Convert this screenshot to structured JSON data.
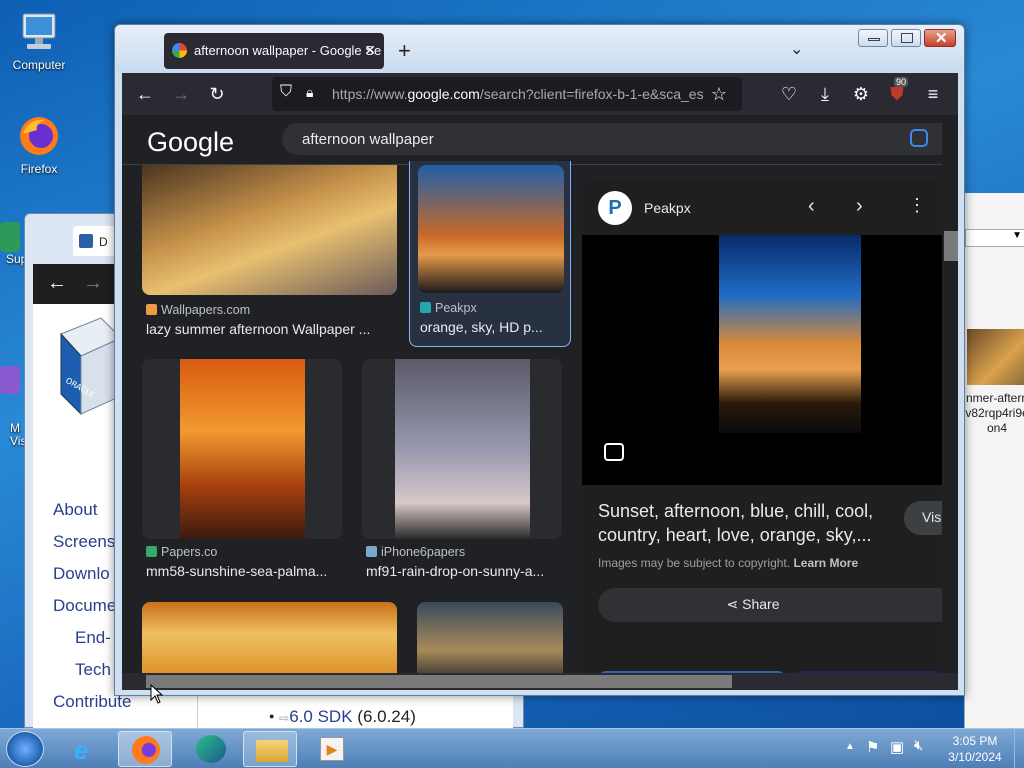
{
  "desktop": {
    "icons": [
      {
        "label": "Computer"
      },
      {
        "label": "Firefox"
      },
      {
        "label": "Sup"
      },
      {
        "label": "M\nVisu"
      }
    ]
  },
  "bg_window": {
    "tab_label": "D",
    "sidebar_links": [
      "About",
      "Screens",
      "Downlo",
      "Docume",
      "End-",
      "Tech",
      "Contribute"
    ],
    "list_item": {
      "link": "6.0 SDK",
      "version": "(6.0.24)"
    }
  },
  "right_window": {
    "caption_lines": [
      "nmer-aftern",
      "v82rqp4ri9e",
      "on4"
    ]
  },
  "firefox": {
    "tab_title": "afternoon wallpaper - Google Se",
    "url_prefix": "https://www.",
    "url_domain": "google.com",
    "url_rest": "/search?client=firefox-b-1-e&sca_es",
    "notification_badge": "90",
    "google": {
      "logo": "Google",
      "query": "afternoon wallpaper",
      "results": [
        {
          "source": "Wallpapers.com",
          "title": "lazy summer afternoon Wallpaper ..."
        },
        {
          "source": "Peakpx",
          "title": "orange, sky, HD p..."
        },
        {
          "source": "Papers.co",
          "title": "mm58-sunshine-sea-palma..."
        },
        {
          "source": "iPhone6papers",
          "title": "mf91-rain-drop-on-sunny-a..."
        }
      ],
      "panel": {
        "source": "Peakpx",
        "title": "Sunset, afternoon, blue, chill, cool, country, heart, love, orange, sky,...",
        "visit_label": "Visi",
        "copyright": "Images may be subject to copyright.",
        "learn_more": "Learn More",
        "share_label": "Share"
      }
    }
  },
  "taskbar": {
    "time": "3:05 PM",
    "date": "3/10/2024"
  },
  "colors": {
    "desktop_blue": "#1b6cc0",
    "firefox_dark": "#2b2a33",
    "google_bg": "#202124",
    "link_blue": "#2a3f8f"
  }
}
